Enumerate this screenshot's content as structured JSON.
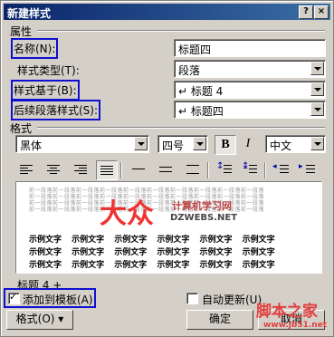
{
  "window": {
    "title": "新建样式",
    "help_btn": "?",
    "close_btn": "×"
  },
  "properties": {
    "group_label": "属性",
    "name_label": "名称(N):",
    "name_value": "标题四",
    "style_type_label": "样式类型(T):",
    "style_type_value": "段落",
    "based_on_label": "样式基于(B):",
    "based_on_value": "↵ 标题 4",
    "next_style_label": "后续段落样式(S):",
    "next_style_value": "↵ 标题四"
  },
  "format": {
    "group_label": "格式",
    "font_value": "黑体",
    "size_value": "四号",
    "bold_glyph": "B",
    "italic_glyph": "I",
    "lang_value": "中文"
  },
  "preview": {
    "placeholder_text": "前一段落前一段落前一段落前一段落前一段落前一段落前一段落前一段落前一段落前一段落",
    "sample_text": "示例文字 示例文字 示例文字 示例文字 示例文字 示例文字"
  },
  "description": "标题 4 +",
  "options": {
    "add_to_template_label": "添加到模板(A)",
    "auto_update_label": "自动更新(U)"
  },
  "buttons": {
    "format_label": "格式(O) ▾",
    "ok_label": "确定",
    "cancel_label": "取消"
  },
  "watermarks": {
    "logo_text": "大众",
    "site_cn": "计算机学习网",
    "site_en": "DZWEBS.NET",
    "corner_brand": "脚本之家",
    "corner_url": "www.jb51.net"
  }
}
